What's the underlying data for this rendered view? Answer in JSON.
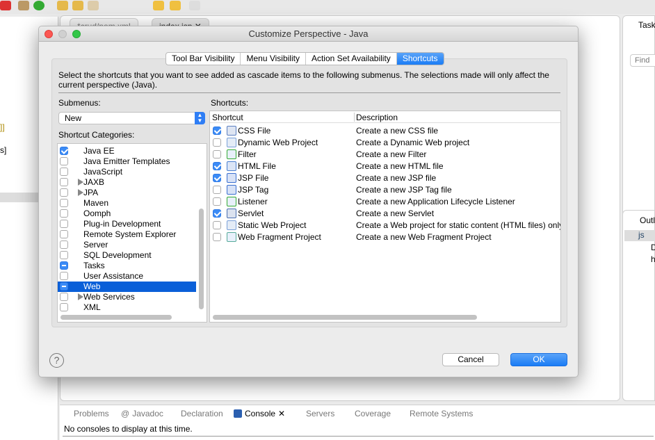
{
  "background": {
    "editor_tabs": [
      "*crud/pom.xml",
      "index.jsp"
    ],
    "right_tab": "Task",
    "find_placeholder": "Find",
    "outline_tab": "Outl",
    "outline_items": [
      "js",
      "D",
      "h"
    ],
    "left_fragments": [
      "]]",
      "s]"
    ],
    "bottom_tabs": [
      "Problems",
      "Javadoc",
      "Declaration",
      "Console",
      "Servers",
      "Coverage",
      "Remote Systems"
    ],
    "active_bottom_tab": "Console",
    "console_message": "No consoles to display at this time."
  },
  "dialog": {
    "title": "Customize Perspective - Java",
    "tabs": [
      "Tool Bar Visibility",
      "Menu Visibility",
      "Action Set Availability",
      "Shortcuts"
    ],
    "selected_tab": "Shortcuts",
    "instructions": "Select the shortcuts that you want to see added as cascade items to the following submenus.  The selections made will only affect the current perspective (Java).",
    "submenus_label": "Submenus:",
    "submenu_value": "New",
    "categories_label": "Shortcut Categories:",
    "categories": [
      {
        "label": "Java EE",
        "state": "checked",
        "expandable": false
      },
      {
        "label": "Java Emitter Templates",
        "state": "unchecked",
        "expandable": false
      },
      {
        "label": "JavaScript",
        "state": "unchecked",
        "expandable": false
      },
      {
        "label": "JAXB",
        "state": "unchecked",
        "expandable": true
      },
      {
        "label": "JPA",
        "state": "unchecked",
        "expandable": true
      },
      {
        "label": "Maven",
        "state": "unchecked",
        "expandable": false
      },
      {
        "label": "Oomph",
        "state": "unchecked",
        "expandable": false
      },
      {
        "label": "Plug-in Development",
        "state": "unchecked",
        "expandable": false
      },
      {
        "label": "Remote System Explorer",
        "state": "unchecked",
        "expandable": false
      },
      {
        "label": "Server",
        "state": "unchecked",
        "expandable": false
      },
      {
        "label": "SQL Development",
        "state": "unchecked",
        "expandable": false
      },
      {
        "label": "Tasks",
        "state": "mixed",
        "expandable": false
      },
      {
        "label": "User Assistance",
        "state": "unchecked",
        "expandable": false
      },
      {
        "label": "Web",
        "state": "mixed",
        "expandable": false,
        "selected": true
      },
      {
        "label": "Web Services",
        "state": "unchecked",
        "expandable": true
      },
      {
        "label": "XML",
        "state": "unchecked",
        "expandable": false
      }
    ],
    "shortcuts_label": "Shortcuts:",
    "columns": [
      "Shortcut",
      "Description"
    ],
    "shortcuts": [
      {
        "name": "CSS File",
        "description": "Create a new CSS file",
        "checked": true,
        "icon": "css-file-icon"
      },
      {
        "name": "Dynamic Web Project",
        "description": "Create a Dynamic Web project",
        "checked": false,
        "icon": "web-project-icon"
      },
      {
        "name": "Filter",
        "description": "Create a new Filter",
        "checked": false,
        "icon": "filter-icon"
      },
      {
        "name": "HTML File",
        "description": "Create a new HTML file",
        "checked": true,
        "icon": "html-file-icon"
      },
      {
        "name": "JSP File",
        "description": "Create a new JSP file",
        "checked": true,
        "icon": "jsp-file-icon"
      },
      {
        "name": "JSP Tag",
        "description": "Create a new JSP Tag file",
        "checked": false,
        "icon": "jsp-tag-icon"
      },
      {
        "name": "Listener",
        "description": "Create a new Application Lifecycle Listener",
        "checked": false,
        "icon": "listener-icon"
      },
      {
        "name": "Servlet",
        "description": "Create a new Servlet",
        "checked": true,
        "icon": "servlet-icon"
      },
      {
        "name": "Static Web Project",
        "description": "Create a Web project for static content (HTML files) only",
        "checked": false,
        "icon": "static-web-project-icon"
      },
      {
        "name": "Web Fragment Project",
        "description": "Create a new Web Fragment Project",
        "checked": false,
        "icon": "web-fragment-project-icon"
      }
    ],
    "cancel_label": "Cancel",
    "ok_label": "OK",
    "help_label": "?"
  },
  "colors": {
    "accent": "#1a7cf5",
    "selection": "#0a5fd8"
  }
}
